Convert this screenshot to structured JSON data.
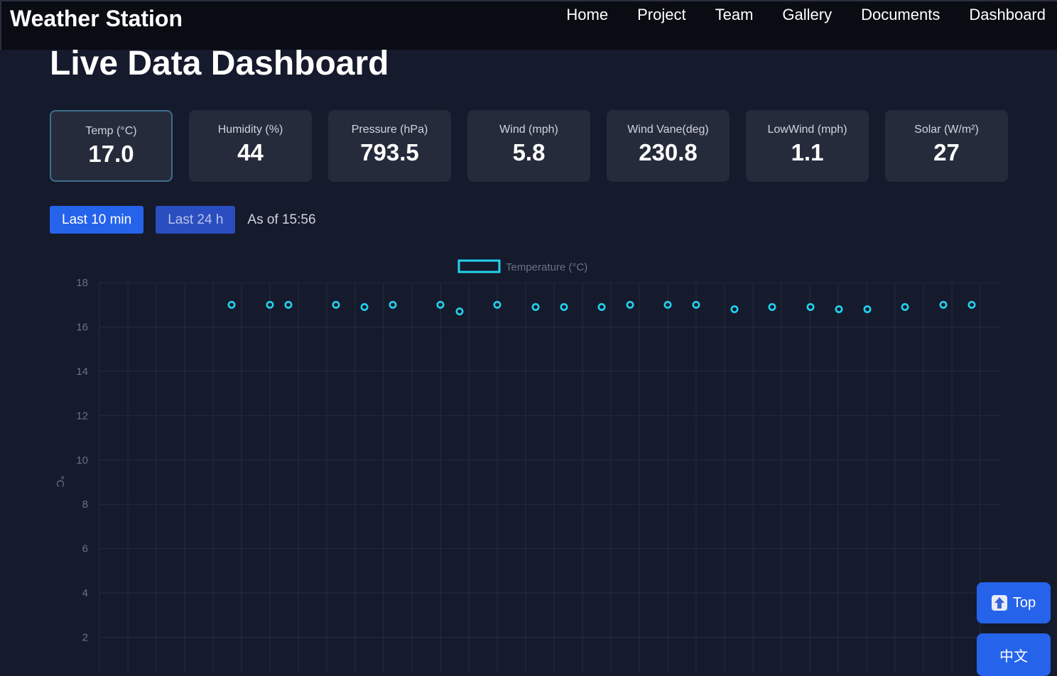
{
  "header": {
    "brand": "Weather Station",
    "nav": [
      "Home",
      "Project",
      "Team",
      "Gallery",
      "Documents",
      "Dashboard"
    ]
  },
  "page_title": "Live Data Dashboard",
  "cards": [
    {
      "label": "Temp (°C)",
      "value": "17.0"
    },
    {
      "label": "Humidity (%)",
      "value": "44"
    },
    {
      "label": "Pressure (hPa)",
      "value": "793.5"
    },
    {
      "label": "Wind (mph)",
      "value": "5.8"
    },
    {
      "label": "Wind Vane(deg)",
      "value": "230.8"
    },
    {
      "label": "LowWind (mph)",
      "value": "1.1"
    },
    {
      "label": "Solar (W/m²)",
      "value": "27"
    }
  ],
  "controls": {
    "last10": "Last 10 min",
    "last24": "Last 24 h",
    "as_of": "As of 15:56"
  },
  "buttons": {
    "top_label": "Top",
    "lang_label": "中文"
  },
  "colors": {
    "accent": "#2563eb",
    "series": "#22d3ee",
    "background": "#151a2c"
  },
  "chart_data": {
    "type": "scatter",
    "legend": "Temperature (°C)",
    "legend_position": "top-center",
    "ylabel": "°C",
    "xlabel": "",
    "yticks": [
      2,
      4,
      6,
      8,
      10,
      12,
      14,
      16,
      18
    ],
    "ylim": [
      0,
      18
    ],
    "grid": true,
    "series": [
      {
        "name": "Temperature (°C)",
        "values": [
          17.0,
          17.0,
          17.0,
          17.0,
          16.9,
          17.0,
          17.0,
          16.7,
          17.0,
          16.9,
          16.9,
          16.9,
          17.0,
          17.0,
          17.0,
          16.8,
          16.9,
          16.9,
          16.8,
          16.8,
          16.9,
          17.0,
          17.0
        ]
      }
    ]
  }
}
